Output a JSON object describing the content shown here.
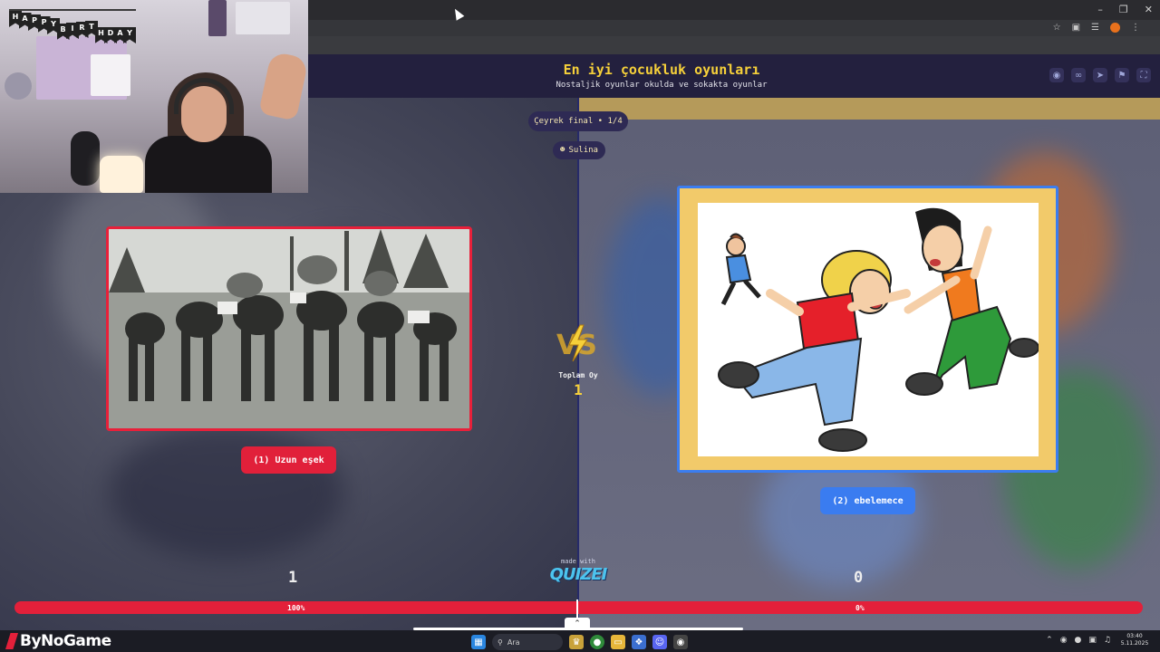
{
  "header": {
    "title": "En iyi çocukluk oyunları",
    "subtitle": "Nostaljik oyunlar okulda ve sokakta oyunlar"
  },
  "round": {
    "label": "Çeyrek final • 1/4"
  },
  "user": {
    "name": "Sulina"
  },
  "left_choice": {
    "label": "(1) Uzun eşek",
    "score": "1",
    "percent": "100%",
    "fill": 1.0
  },
  "right_choice": {
    "label": "(2) ebelemece",
    "score": "0",
    "percent": "0%",
    "fill": 0.0
  },
  "totals": {
    "label": "Toplam Oy",
    "value": "1"
  },
  "branding": {
    "made_with": "made with",
    "logo": "QUIZEI"
  },
  "overlay": {
    "brand": "ByNoGame",
    "banner_letters": [
      "H",
      "A",
      "P",
      "P",
      "Y",
      "B",
      "I",
      "R",
      "T",
      "H",
      "D",
      "A",
      "Y"
    ]
  },
  "taskbar": {
    "search_placeholder": "Ara",
    "time": "03:40",
    "date": "5.11.2025"
  },
  "colors": {
    "accent_red": "#e3203a",
    "accent_blue": "#3a7cf0",
    "title_yellow": "#f6d03a",
    "header_bg": "#23203e"
  },
  "icons": [
    "eye-icon",
    "link-icon",
    "send-icon",
    "flag-icon",
    "fullscreen-icon",
    "star-icon",
    "extensions-icon",
    "search-icon",
    "windows-icon"
  ]
}
